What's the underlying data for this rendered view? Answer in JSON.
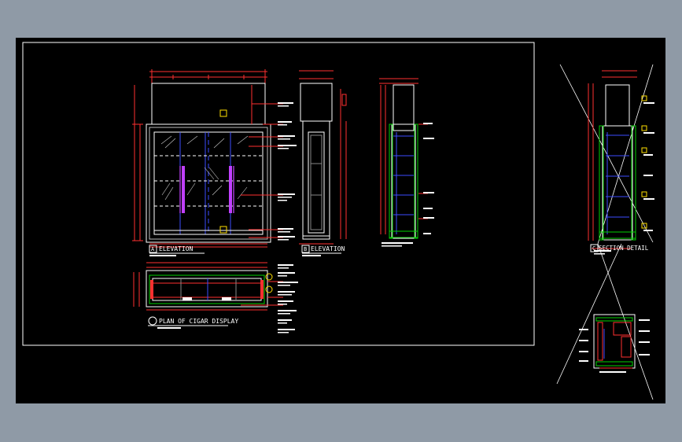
{
  "drawing": {
    "titles": {
      "elevation_a": "ELEVATION",
      "elevation_b": "ELEVATION",
      "plan": "PLAN OF CIGAR DISPLAY",
      "section_detail": "SECTION DETAIL"
    },
    "markers": {
      "a": "A",
      "b": "B",
      "c": "C"
    },
    "colors": {
      "background": "#000000",
      "frame": "#ffffff",
      "dimension": "#ff3030",
      "glass": "#3b4cff",
      "handle": "#c040ff",
      "accent": "#00d000",
      "marker": "#ffe000"
    }
  }
}
